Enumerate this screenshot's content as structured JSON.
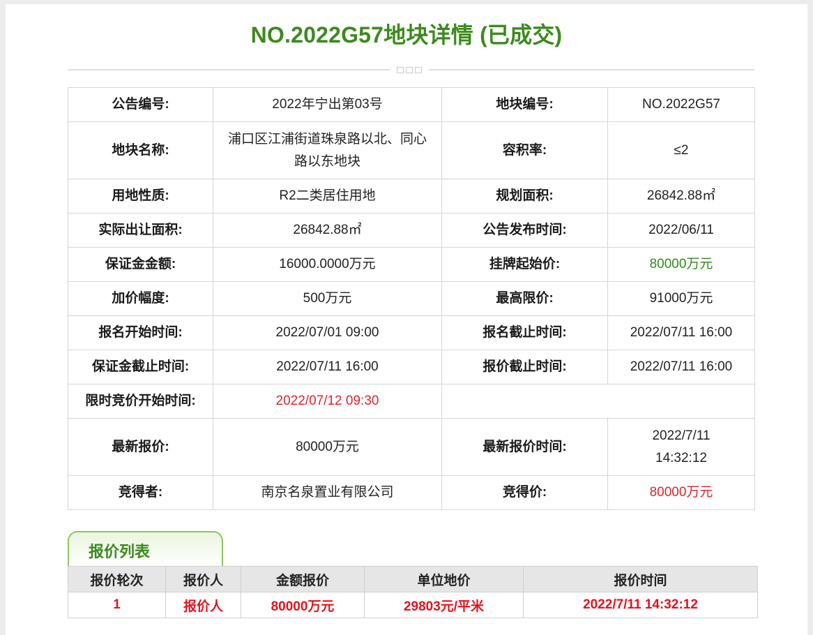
{
  "page_title": "NO.2022G57地块详情 (已成交)",
  "details": {
    "announcement_no_label": "公告编号:",
    "announcement_no": "2022年宁出第03号",
    "plot_no_label": "地块编号:",
    "plot_no": "NO.2022G57",
    "plot_name_label": "地块名称:",
    "plot_name": "浦口区江浦街道珠泉路以北、同心路以东地块",
    "far_label": "容积率:",
    "far": "≤2",
    "land_use_label": "用地性质:",
    "land_use": "R2二类居住用地",
    "planned_area_label": "规划面积:",
    "planned_area": "26842.88㎡",
    "actual_area_label": "实际出让面积:",
    "actual_area": "26842.88㎡",
    "publish_time_label": "公告发布时间:",
    "publish_time": "2022/06/11",
    "deposit_label": "保证金金额:",
    "deposit": "16000.0000万元",
    "start_price_label": "挂牌起始价:",
    "start_price": "80000万元",
    "increment_label": "加价幅度:",
    "increment": "500万元",
    "max_price_label": "最高限价:",
    "max_price": "91000万元",
    "reg_start_label": "报名开始时间:",
    "reg_start": "2022/07/01 09:00",
    "reg_end_label": "报名截止时间:",
    "reg_end": "2022/07/11 16:00",
    "deposit_deadline_label": "保证金截止时间:",
    "deposit_deadline": "2022/07/11 16:00",
    "bid_deadline_label": "报价截止时间:",
    "bid_deadline": "2022/07/11 16:00",
    "timed_bid_start_label": "限时竞价开始时间:",
    "timed_bid_start": "2022/07/12 09:30",
    "latest_bid_label": "最新报价:",
    "latest_bid": "80000万元",
    "latest_bid_time_label": "最新报价时间:",
    "latest_bid_time": "2022/7/11 14:32:12",
    "winner_label": "竞得者:",
    "winner": "南京名泉置业有限公司",
    "winning_price_label": "竞得价:",
    "winning_price": "80000万元"
  },
  "bid_list": {
    "tab_label": "报价列表",
    "headers": [
      "报价轮次",
      "报价人",
      "金额报价",
      "单位地价",
      "报价时间"
    ],
    "rows": [
      [
        "1",
        "报价人",
        "80000万元",
        "29803元/平米",
        "2022/7/11 14:32:12"
      ]
    ]
  },
  "colors": {
    "accent_green": "#3d8a1f",
    "highlight_red": "#d9262b"
  }
}
